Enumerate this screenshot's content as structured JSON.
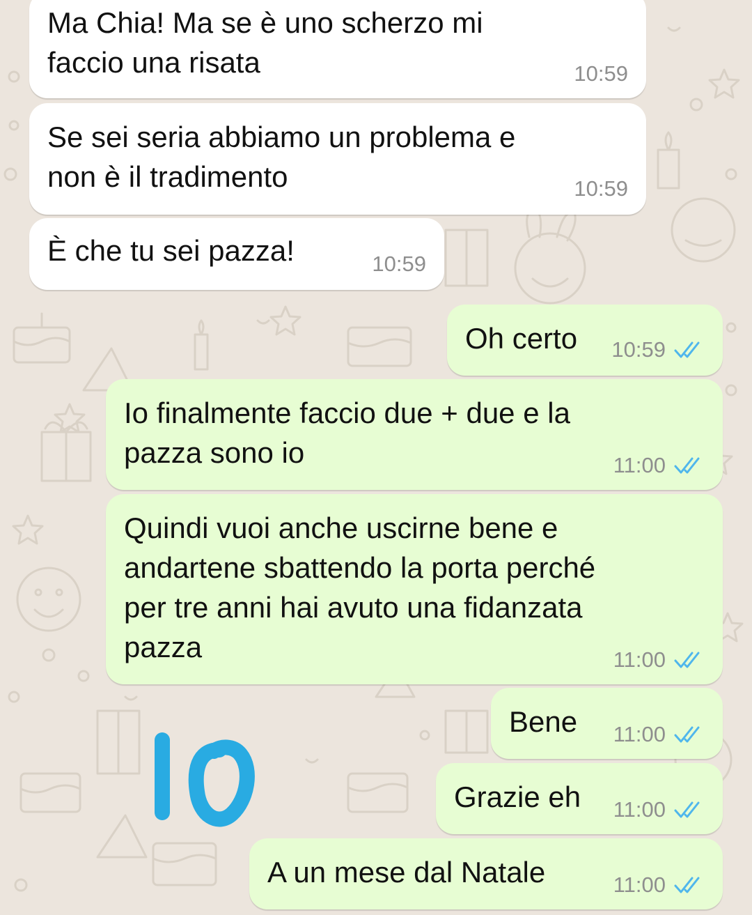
{
  "messages": [
    {
      "direction": "incoming",
      "text": "Ma Chia! Ma se è uno scherzo mi\nfaccio una risata",
      "time": "10:59"
    },
    {
      "direction": "incoming",
      "text": "Se sei seria abbiamo un problema e\nnon è il tradimento",
      "time": "10:59"
    },
    {
      "direction": "incoming",
      "text": "È che tu sei pazza!",
      "time": "10:59"
    },
    {
      "direction": "outgoing",
      "text": "Oh certo",
      "time": "10:59",
      "status": "read"
    },
    {
      "direction": "outgoing",
      "text": "Io finalmente faccio due + due e la\npazza sono io",
      "time": "11:00",
      "status": "read"
    },
    {
      "direction": "outgoing",
      "text": "Quindi vuoi anche uscirne bene e\nandartene sbattendo la porta perché\nper tre anni hai avuto una fidanzata\npazza",
      "time": "11:00",
      "status": "read"
    },
    {
      "direction": "outgoing",
      "text": "Bene",
      "time": "11:00",
      "status": "read"
    },
    {
      "direction": "outgoing",
      "text": "Grazie eh",
      "time": "11:00",
      "status": "read"
    },
    {
      "direction": "outgoing",
      "text": "A un mese dal Natale",
      "time": "11:00",
      "status": "read"
    }
  ],
  "annotation": {
    "text": "10",
    "color": "#29abe2"
  },
  "colors": {
    "incoming_bubble": "#ffffff",
    "outgoing_bubble": "#e7fdd3",
    "read_ticks": "#4fb6ec",
    "timestamp": "#8e8e8e",
    "wallpaper": "#ece5dd"
  }
}
